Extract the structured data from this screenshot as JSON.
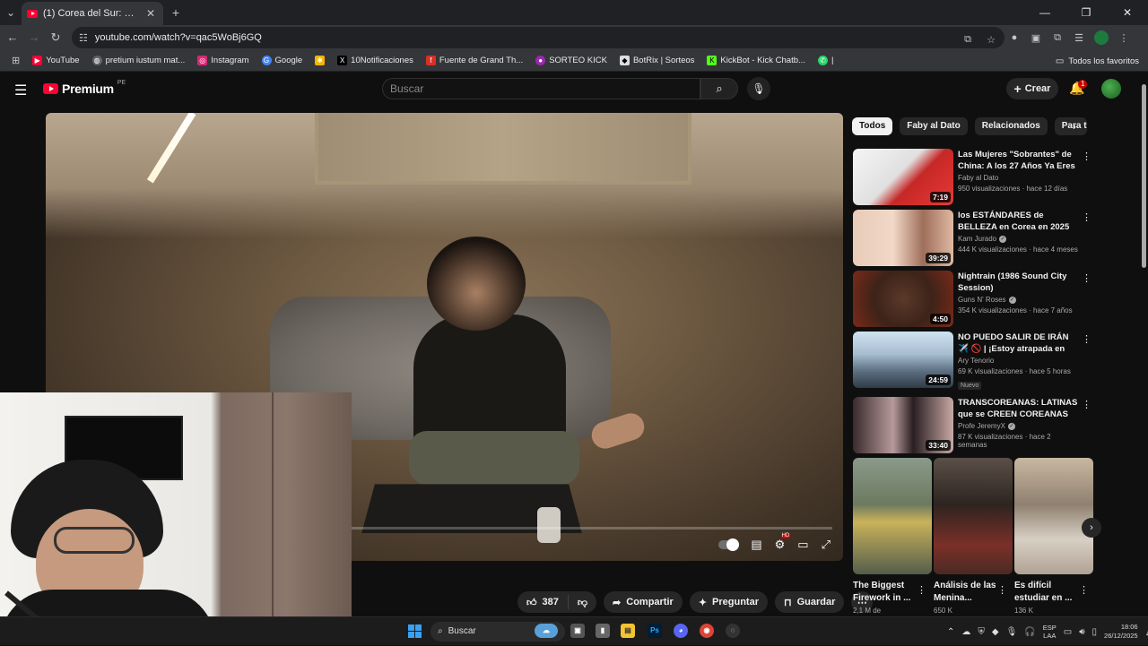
{
  "browser": {
    "tab_title": "(1) Corea del Sur: RICOS pero II",
    "url": "youtube.com/watch?v=qac5WoBj6GQ",
    "bookmarks": [
      {
        "label": "YouTube",
        "color": "#ff0033"
      },
      {
        "label": "pretium iustum mat...",
        "color": "#5f6368"
      },
      {
        "label": "Instagram",
        "color": "#d62976"
      },
      {
        "label": "Google",
        "color": "#4285f4"
      },
      {
        "label": "",
        "color": "#f4b400"
      },
      {
        "label": "10Notificaciones",
        "color": "#000000"
      },
      {
        "label": "Fuente de Grand Th...",
        "color": "#d93025"
      },
      {
        "label": "SORTEO KICK",
        "color": "#9c27b0"
      },
      {
        "label": "BotRix | Sorteos",
        "color": "#ffffff"
      },
      {
        "label": "KickBot - Kick Chatb...",
        "color": "#53fc18"
      },
      {
        "label": "|",
        "color": "#25d366"
      }
    ],
    "all_favorites": "Todos los favoritos"
  },
  "yt": {
    "logo_word": "Premium",
    "country": "PE",
    "search_placeholder": "Buscar",
    "create_label": "Crear",
    "notif_count": "1"
  },
  "video": {
    "likes": "387",
    "share": "Compartir",
    "ask": "Preguntar",
    "save": "Guardar"
  },
  "chips": [
    "Todos",
    "Faby al Dato",
    "Relacionados",
    "Para ti"
  ],
  "recommendations": [
    {
      "title": "Las Mujeres \"Sobrantes\" de China: A los 27 Años Ya Eres ...",
      "channel": "Faby al Dato",
      "verified": false,
      "stats": "950 visualizaciones · hace 12 días",
      "duration": "7:19",
      "badge": ""
    },
    {
      "title": "los ESTÁNDARES de BELLEZA en Corea en 2025 son más ...",
      "channel": "Kam Jurado",
      "verified": true,
      "stats": "444 K visualizaciones · hace 4 meses",
      "duration": "39:29",
      "badge": ""
    },
    {
      "title": "Nightrain (1986 Sound City Session)",
      "channel": "Guns N' Roses",
      "verified": true,
      "stats": "354 K visualizaciones · hace 7 años",
      "duration": "4:50",
      "badge": ""
    },
    {
      "title": "NO PUEDO SALIR DE IRÁN ✈️ 🚫 | ¡Estoy atrapada en este ...",
      "channel": "Ary Tenorio",
      "verified": false,
      "stats": "69 K visualizaciones · hace 5 horas",
      "duration": "24:59",
      "badge": "Nuevo"
    },
    {
      "title": "TRANSCOREANAS: LATINAS que se CREEN COREANAS",
      "channel": "Profe JeremyX",
      "verified": true,
      "stats": "87 K visualizaciones · hace 2 semanas",
      "duration": "33:40",
      "badge": ""
    }
  ],
  "shorts": [
    {
      "title": "The Biggest Firework in ...",
      "views": "2,1 M de"
    },
    {
      "title": "Análisis de las Menina...",
      "views": "650 K"
    },
    {
      "title": "Es difícil estudiar en ...",
      "views": "136 K"
    }
  ],
  "taskbar": {
    "search": "Buscar",
    "lang_top": "ESP",
    "lang_bottom": "LAA",
    "time": "18:06",
    "date": "26/12/2025"
  }
}
